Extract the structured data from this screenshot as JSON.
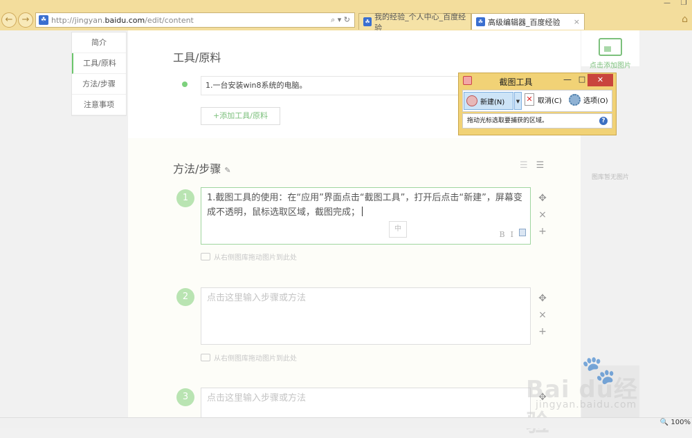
{
  "browser": {
    "url_prefix": "http://jingyan.",
    "url_host": "baidu.com",
    "url_path": "/edit/content",
    "addr_tools": "⌕ ▾ ↻",
    "tabs": [
      {
        "title": "我的经验_个人中心_百度经验"
      },
      {
        "title": "高级编辑器_百度经验",
        "close": "×"
      }
    ],
    "back": "←",
    "forward": "→",
    "home": "⌂",
    "minimize": "—",
    "restore": "❐"
  },
  "left_nav": {
    "items": [
      {
        "label": "简介"
      },
      {
        "label": "工具/原料"
      },
      {
        "label": "方法/步骤"
      },
      {
        "label": "注意事项"
      }
    ]
  },
  "tools_section": {
    "title": "工具/原料",
    "item": "1.一台安装win8系统的电脑。",
    "add_button": "+添加工具/原料"
  },
  "steps_section": {
    "title": "方法/步骤",
    "pencil": "✎",
    "list_icons": [
      "☰",
      "☰"
    ],
    "drag_hint": "从右侧图库拖动图片到此处",
    "steps": [
      {
        "num": "1",
        "text": "1.截图工具的使用：在“应用”界面点击“截图工具”，打开后点击“新建”，屏幕变成不透明，鼠标选取区域，截图完成；",
        "ime": "中"
      },
      {
        "num": "2",
        "placeholder": "点击这里输入步骤或方法"
      },
      {
        "num": "3",
        "placeholder": "点击这里输入步骤或方法"
      }
    ],
    "format": {
      "bold": "B",
      "italic": "I"
    },
    "step_tools": {
      "move": "✥",
      "delete": "×",
      "add": "+"
    }
  },
  "right_panel": {
    "add_image": "点击添加图片",
    "no_image": "图库暂无图片"
  },
  "snipping_tool": {
    "title": "截图工具",
    "minimize": "—",
    "maximize": "□",
    "close": "✕",
    "new_label": "新建(N)",
    "dropdown": "▼",
    "cancel_label": "取消(C)",
    "cancel_icon": "✕",
    "options_label": "选项(O)",
    "status": "拖动光标选取要捕获的区域。",
    "help": "?"
  },
  "watermark": {
    "brand": "Bai du经验",
    "domain": "jingyan.baidu.com",
    "paw": "🐾"
  },
  "status_bar": {
    "zoom": "🔍 100%"
  }
}
